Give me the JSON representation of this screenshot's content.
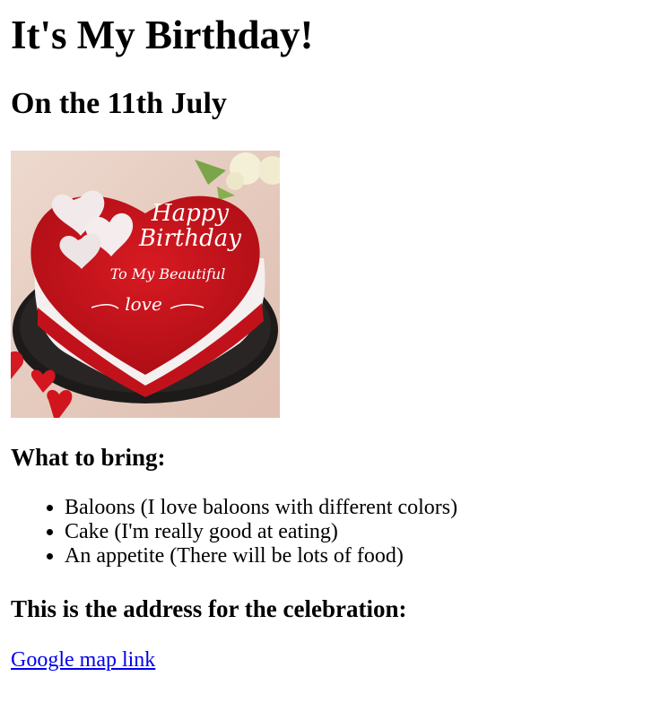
{
  "page": {
    "title": "It's My Birthday!",
    "subtitle": "On the 11th July",
    "cake_image": {
      "alt_icon": "birthday-cake-image",
      "inscription_line1": "Happy",
      "inscription_line2": "Birthday",
      "inscription_line3": "To My Beautiful",
      "inscription_line4": "love"
    },
    "bring_heading": "What to bring:",
    "bring_items": [
      "Baloons (I love baloons with different colors)",
      "Cake (I'm really good at eating)",
      "An appetite (There will be lots of food)"
    ],
    "address_heading": "This is the address for the celebration:",
    "map_link": "Google map link",
    "colors": {
      "link": "#0000ee",
      "cake_red": "#c8141e",
      "cream": "#f4f1f0",
      "background_beige": "#e7d0c4"
    }
  }
}
